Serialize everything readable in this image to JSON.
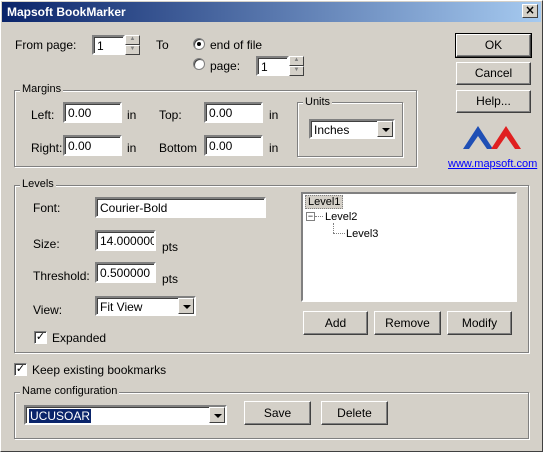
{
  "window": {
    "title": "Mapsoft BookMarker",
    "close_glyph": "×"
  },
  "pages": {
    "from_label": "From page:",
    "from_value": "1",
    "to_label": "To",
    "end_of_file_label": "end of file",
    "page_label": "page:",
    "page_value": "1",
    "selected": "end_of_file"
  },
  "buttons": {
    "ok": "OK",
    "cancel": "Cancel",
    "help": "Help..."
  },
  "logo": {
    "link_text": "www.mapsoft.com",
    "colors": [
      "#1f4fb5",
      "#e02020"
    ]
  },
  "margins": {
    "title": "Margins",
    "left_label": "Left:",
    "left_value": "0.00",
    "left_unit": "in",
    "top_label": "Top:",
    "top_value": "0.00",
    "top_unit": "in",
    "right_label": "Right:",
    "right_value": "0.00",
    "right_unit": "in",
    "bottom_label": "Bottom",
    "bottom_value": "0.00",
    "bottom_unit": "in",
    "units_title": "Units",
    "units_value": "Inches"
  },
  "levels": {
    "title": "Levels",
    "font_label": "Font:",
    "font_value": "Courier-Bold",
    "size_label": "Size:",
    "size_value": "14.000000",
    "size_unit": "pts",
    "threshold_label": "Threshold:",
    "threshold_value": "0.500000",
    "threshold_unit": "pts",
    "view_label": "View:",
    "view_value": "Fit View",
    "expanded_label": "Expanded",
    "expanded_checked": true,
    "tree": [
      "Level1",
      "Level2",
      "Level3"
    ],
    "tree_expander": "−",
    "add": "Add",
    "remove": "Remove",
    "modify": "Modify"
  },
  "keep_existing": {
    "label": "Keep existing bookmarks",
    "checked": true
  },
  "name_config": {
    "title": "Name configuration",
    "value": "UCUSOAR",
    "save": "Save",
    "delete": "Delete"
  },
  "check_glyph": "✓"
}
